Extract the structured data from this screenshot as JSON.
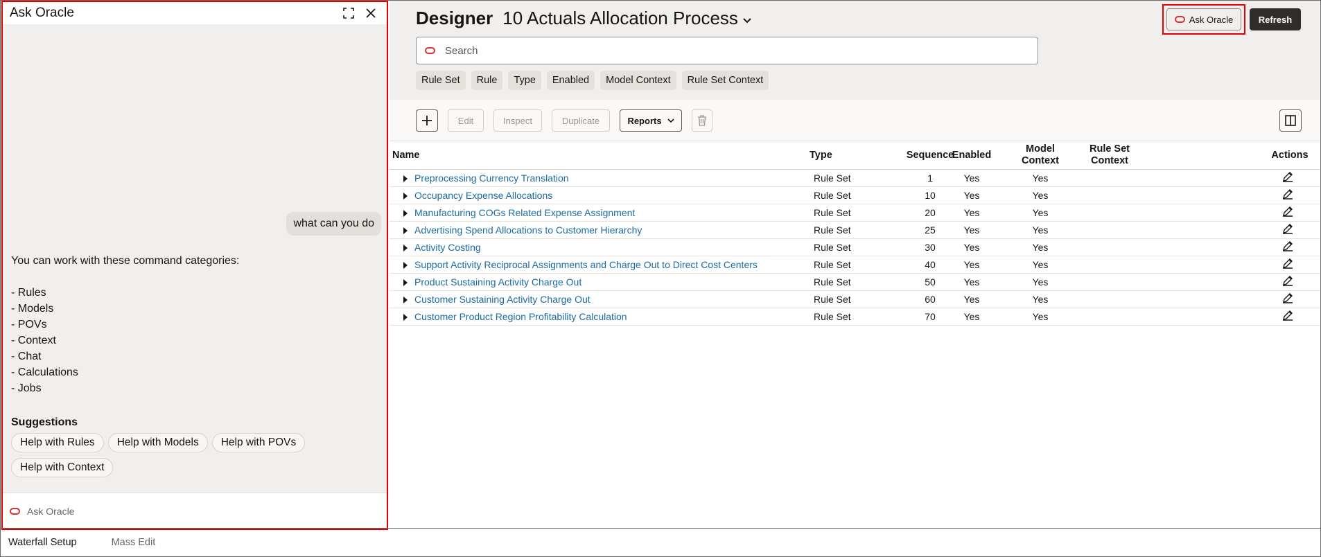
{
  "chat": {
    "title": "Ask Oracle",
    "user_message": "what can you do",
    "reply_intro": "You can work with these command categories:",
    "categories": [
      "- Rules",
      "- Models",
      "- POVs",
      "- Context",
      "- Chat",
      "- Calculations",
      "- Jobs"
    ],
    "suggestions_title": "Suggestions",
    "suggestions": [
      "Help with Rules",
      "Help with Models",
      "Help with POVs",
      "Help with Context"
    ],
    "input_placeholder": "Ask Oracle"
  },
  "header": {
    "designer": "Designer",
    "process": "10 Actuals Allocation Process",
    "ask_oracle": "Ask Oracle",
    "refresh": "Refresh"
  },
  "search": {
    "placeholder": "Search"
  },
  "filters": [
    "Rule Set",
    "Rule",
    "Type",
    "Enabled",
    "Model Context",
    "Rule Set Context"
  ],
  "toolbar": {
    "edit": "Edit",
    "inspect": "Inspect",
    "duplicate": "Duplicate",
    "reports": "Reports"
  },
  "columns": {
    "name": "Name",
    "type": "Type",
    "sequence": "Sequence",
    "enabled": "Enabled",
    "model_context_1": "Model",
    "model_context_2": "Context",
    "rule_set_context_1": "Rule Set",
    "rule_set_context_2": "Context",
    "actions": "Actions"
  },
  "rows": [
    {
      "name": "Preprocessing Currency Translation",
      "type": "Rule Set",
      "sequence": "1",
      "enabled": "Yes",
      "model_context": "Yes"
    },
    {
      "name": "Occupancy Expense Allocations",
      "type": "Rule Set",
      "sequence": "10",
      "enabled": "Yes",
      "model_context": "Yes"
    },
    {
      "name": "Manufacturing COGs Related Expense Assignment",
      "type": "Rule Set",
      "sequence": "20",
      "enabled": "Yes",
      "model_context": "Yes"
    },
    {
      "name": "Advertising Spend Allocations to Customer Hierarchy",
      "type": "Rule Set",
      "sequence": "25",
      "enabled": "Yes",
      "model_context": "Yes"
    },
    {
      "name": "Activity Costing",
      "type": "Rule Set",
      "sequence": "30",
      "enabled": "Yes",
      "model_context": "Yes"
    },
    {
      "name": "Support Activity Reciprocal Assignments and Charge Out to Direct Cost Centers",
      "type": "Rule Set",
      "sequence": "40",
      "enabled": "Yes",
      "model_context": "Yes"
    },
    {
      "name": "Product Sustaining Activity Charge Out",
      "type": "Rule Set",
      "sequence": "50",
      "enabled": "Yes",
      "model_context": "Yes"
    },
    {
      "name": "Customer Sustaining Activity Charge Out",
      "type": "Rule Set",
      "sequence": "60",
      "enabled": "Yes",
      "model_context": "Yes"
    },
    {
      "name": "Customer Product Region Profitability Calculation",
      "type": "Rule Set",
      "sequence": "70",
      "enabled": "Yes",
      "model_context": "Yes"
    }
  ],
  "tabs": [
    "Waterfall Setup",
    "Mass Edit"
  ],
  "colors": {
    "brand_red": "#d5302f",
    "link": "#1a6ba0",
    "dark_button": "#312d2a",
    "panel_bg": "#f1efed"
  }
}
